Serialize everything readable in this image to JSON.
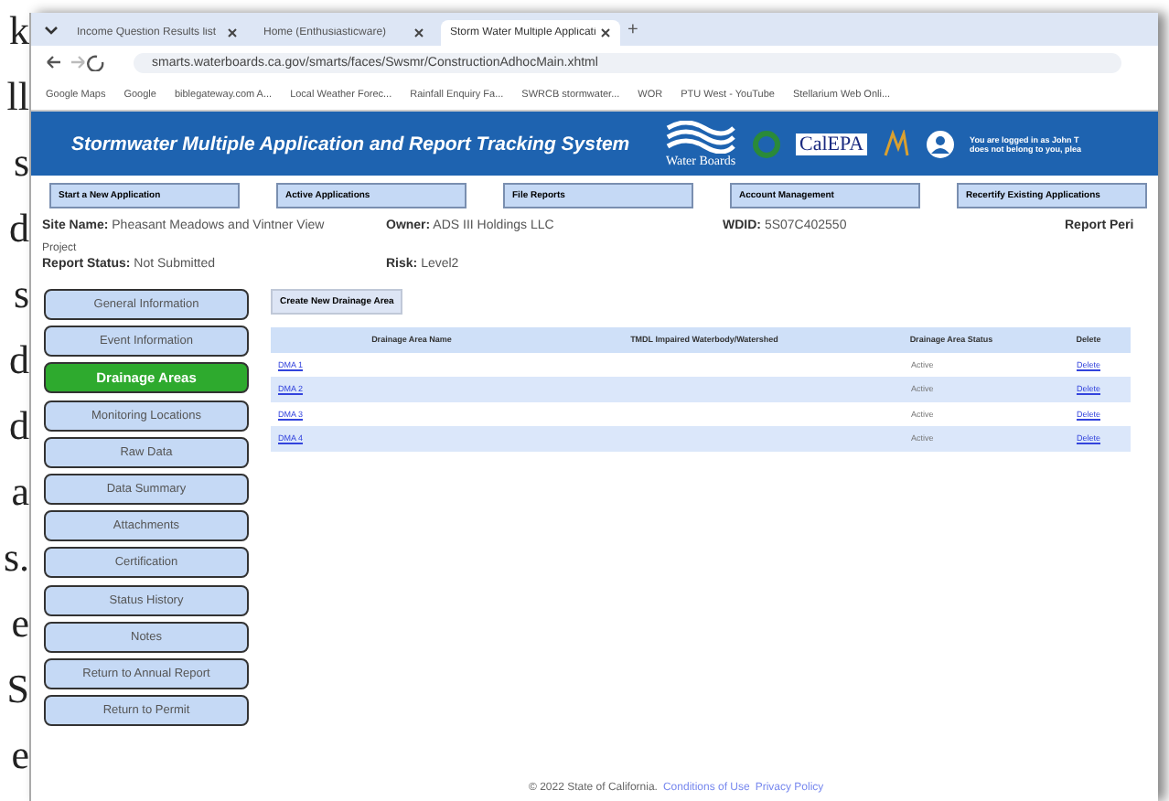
{
  "document_margin": [
    "k",
    "ll",
    "s",
    "d",
    "s",
    "d",
    "d",
    "a",
    "s.",
    "e",
    "S",
    "e"
  ],
  "browser": {
    "tabs": [
      {
        "title": "Income Question Results list",
        "selected": false
      },
      {
        "title": "Home (Enthusiasticware)",
        "selected": false
      },
      {
        "title": "Storm Water Multiple Applicati",
        "selected": true
      }
    ],
    "new_tab": "+",
    "url": "smarts.waterboards.ca.gov/smarts/faces/Swsmr/ConstructionAdhocMain.xhtml",
    "bookmarks": [
      "Google Maps",
      "Google",
      "biblegateway.com A...",
      "Local Weather Forec...",
      "Rainfall Enquiry Fa...",
      "SWRCB stormwater...",
      "WOR",
      "PTU West - YouTube",
      "Stellarium Web Onli..."
    ]
  },
  "header": {
    "title": "Stormwater Multiple Application and Report Tracking System",
    "logo_text": "Water Boards",
    "calepa": "CalEPA",
    "login_note": [
      "You are logged in as John T",
      "does not belong to you, plea"
    ]
  },
  "menu": [
    "Start a New Application",
    "Active Applications",
    "File Reports",
    "Account Management",
    "Recertify Existing Applications"
  ],
  "site": {
    "site_label": "Site Name:",
    "site_name": "Pheasant Meadows and Vintner View",
    "site_name_2": "Project",
    "owner_label": "Owner:",
    "owner": "ADS III Holdings LLC",
    "wdid_label": "WDID:",
    "wdid": "5S07C402550",
    "period_label": "Report Peri",
    "status_label": "Report Status:",
    "status": "Not Submitted",
    "risk_label": "Risk:",
    "risk": "Level2"
  },
  "sidebar": [
    {
      "label": "General Information",
      "selected": false
    },
    {
      "label": "Event Information",
      "selected": false
    },
    {
      "label": "Drainage Areas",
      "selected": true
    },
    {
      "label": "Monitoring Locations",
      "selected": false
    },
    {
      "label": "Raw Data",
      "selected": false
    },
    {
      "label": "Data Summary",
      "selected": false
    },
    {
      "label": "Attachments",
      "selected": false
    },
    {
      "label": "Certification",
      "selected": false
    },
    {
      "label": "Status History",
      "selected": false
    },
    {
      "label": "Notes",
      "selected": false
    },
    {
      "label": "Return to Annual Report",
      "selected": false
    },
    {
      "label": "Return to Permit",
      "selected": false
    }
  ],
  "create_button": "Create New Drainage Area",
  "table": {
    "columns": [
      "Drainage Area Name",
      "TMDL Impaired Waterbody/Watershed",
      "Drainage Area Status",
      "Delete"
    ],
    "rows": [
      {
        "name": "DMA 1",
        "status": "Active",
        "delete": "Delete"
      },
      {
        "name": "DMA 2",
        "status": "Active",
        "delete": "Delete"
      },
      {
        "name": "DMA 3",
        "status": "Active",
        "delete": "Delete"
      },
      {
        "name": "DMA 4",
        "status": "Active",
        "delete": "Delete"
      }
    ]
  },
  "footer": {
    "copyright": "© 2022 State of California.",
    "links": [
      "Conditions of Use",
      "Privacy Policy"
    ]
  }
}
